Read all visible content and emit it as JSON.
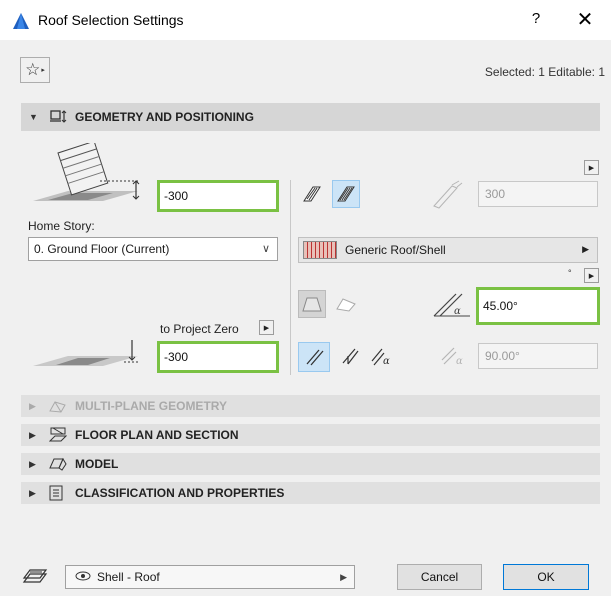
{
  "window": {
    "title": "Roof Selection Settings",
    "help": "?",
    "close": "✕"
  },
  "toolbar": {
    "favorites_icon": "☆",
    "favorites_arrow": "▸",
    "selected_info": "Selected: 1 Editable: 1"
  },
  "sections": {
    "geometry": "GEOMETRY AND POSITIONING",
    "multiplane": "MULTI-PLANE GEOMETRY",
    "floorplan": "FLOOR PLAN AND SECTION",
    "model": "MODEL",
    "classification": "CLASSIFICATION AND PROPERTIES"
  },
  "geometry": {
    "home_offset": "-300",
    "home_story_label": "Home Story:",
    "home_story_value": "0. Ground Floor (Current)",
    "to_project_zero_label": "to Project Zero",
    "project_zero_value": "-300",
    "thickness_value": "300",
    "building_material": "Generic Roof/Shell",
    "pitch_value": "45.00°",
    "edge_angle_value": "90.00°",
    "angle_unit_mark": "°"
  },
  "footer": {
    "layer_value": "Shell - Roof",
    "cancel_label": "Cancel",
    "ok_label": "OK"
  },
  "colors": {
    "highlight": "#7ac143",
    "selected_bg": "#cce4f7"
  }
}
